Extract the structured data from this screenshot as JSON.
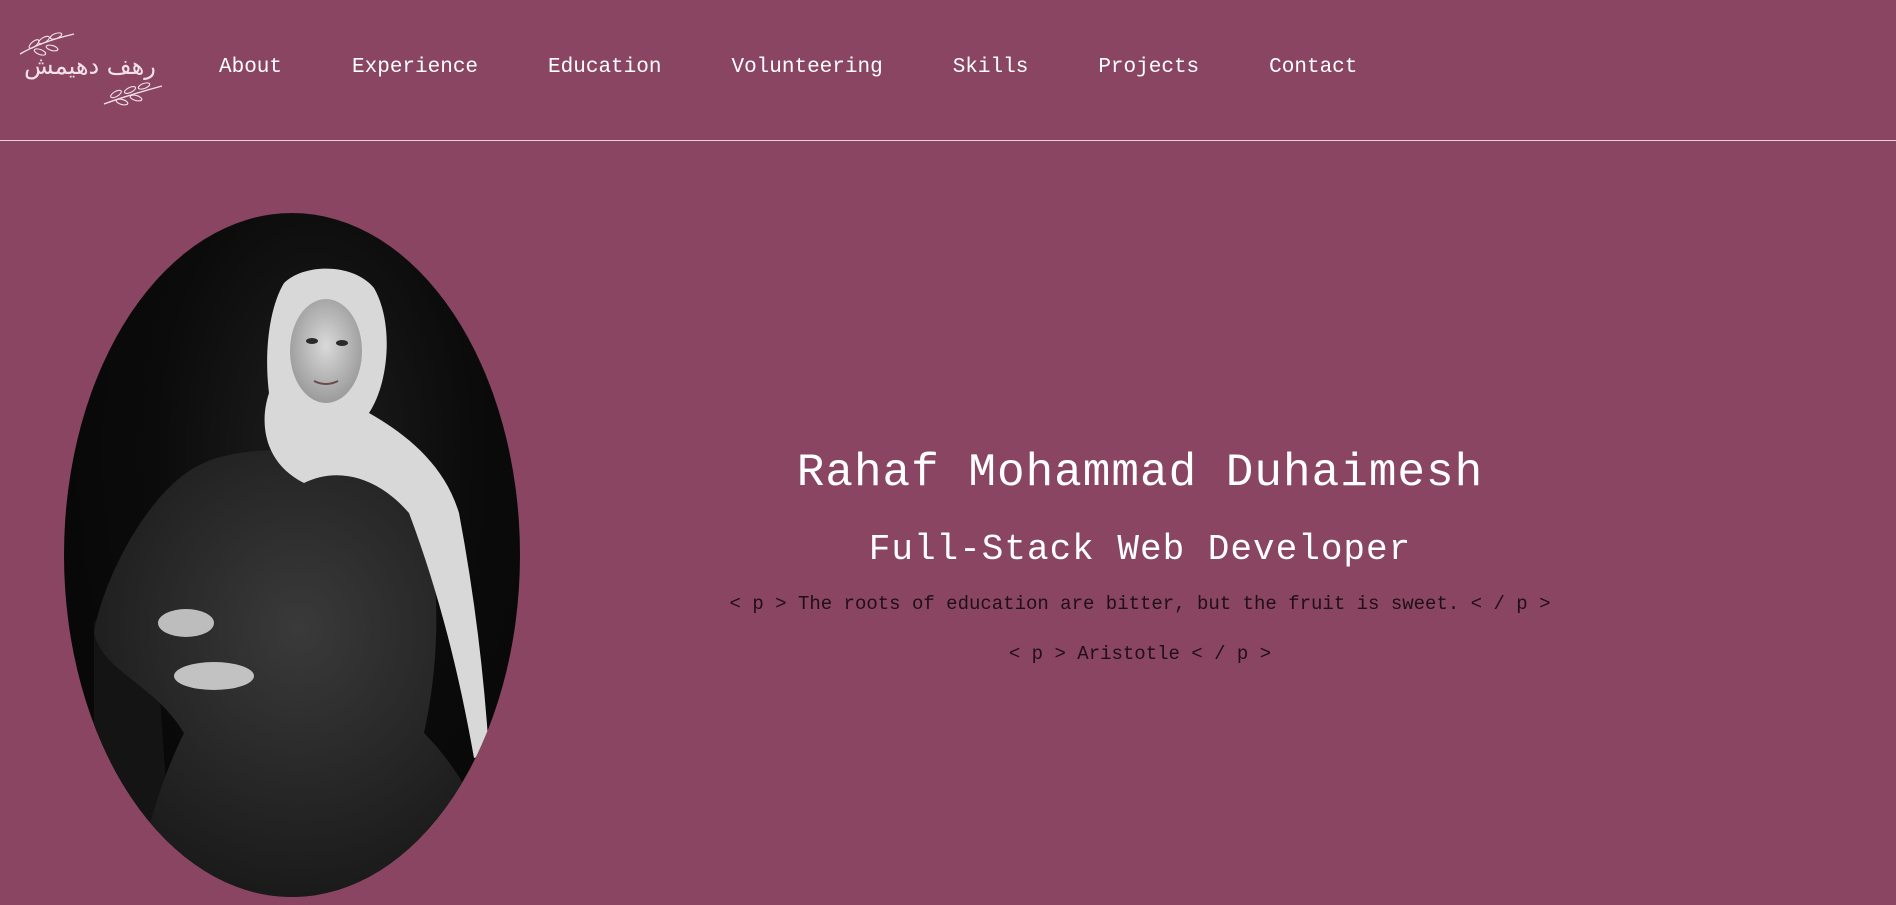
{
  "nav": {
    "logo_text": "رهف دهيمش",
    "links": [
      {
        "label": "About"
      },
      {
        "label": "Experience"
      },
      {
        "label": "Education"
      },
      {
        "label": "Volunteering"
      },
      {
        "label": "Skills"
      },
      {
        "label": "Projects"
      },
      {
        "label": "Contact"
      }
    ]
  },
  "hero": {
    "name": "Rahaf Mohammad Duhaimesh",
    "title": "Full-Stack Web Developer",
    "quote": "< p > The roots of education are bitter, but the fruit is sweet. < / p >",
    "author": "< p > Aristotle < / p >"
  },
  "colors": {
    "background": "#8a4562",
    "text": "#ffffff",
    "quote_text": "#1f0f16"
  },
  "icons": {
    "logo_decoration": "olive-branch-icon"
  }
}
